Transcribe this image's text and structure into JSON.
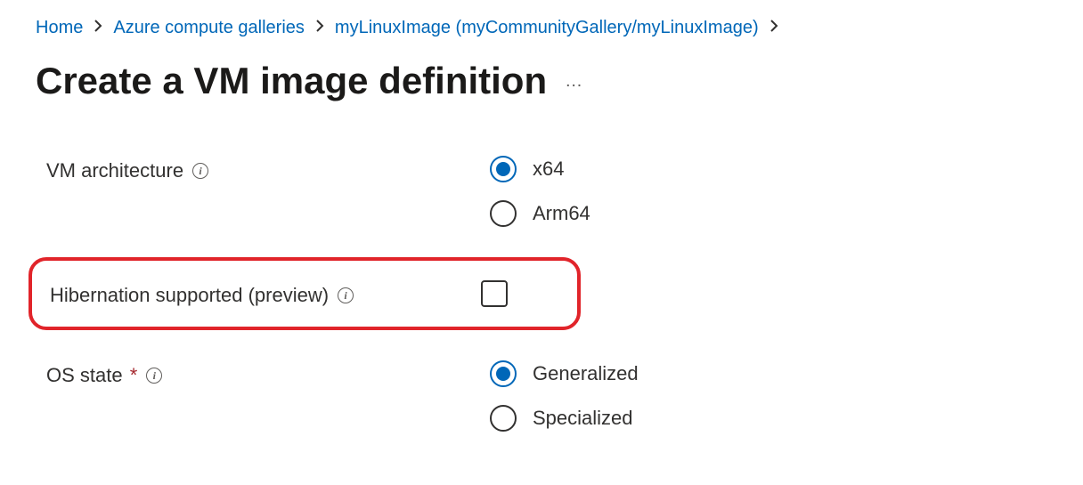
{
  "breadcrumb": {
    "home": "Home",
    "galleries": "Azure compute galleries",
    "image": "myLinuxImage (myCommunityGallery/myLinuxImage)"
  },
  "page": {
    "title": "Create a VM image definition",
    "more_actions": "…"
  },
  "fields": {
    "vm_arch": {
      "label": "VM architecture",
      "options": {
        "x64": "x64",
        "arm64": "Arm64"
      }
    },
    "hibernation": {
      "label": "Hibernation supported (preview)"
    },
    "os_state": {
      "label": "OS state",
      "required_marker": "*",
      "options": {
        "generalized": "Generalized",
        "specialized": "Specialized"
      }
    }
  }
}
